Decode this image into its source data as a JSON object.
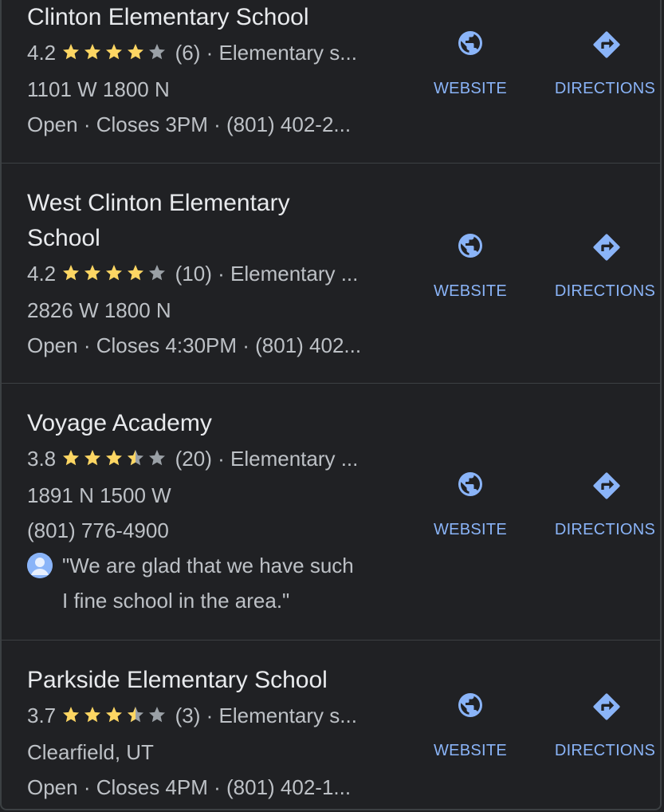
{
  "results": [
    {
      "name": "Clinton Elementary School",
      "rating": "4.2",
      "stars": 4.2,
      "reviews": "(6)",
      "category": "· Elementary s...",
      "address": "1101 W 1800 N",
      "status": "Open",
      "hours": "· Closes 3PM · (801) 402-2...",
      "website_label": "WEBSITE",
      "directions_label": "DIRECTIONS"
    },
    {
      "name_line1": "West Clinton Elementary",
      "name_line2": "School",
      "rating": "4.2",
      "stars": 4.2,
      "reviews": "(10)",
      "category": "· Elementary ...",
      "address": "2826 W 1800 N",
      "status": "Open",
      "hours": "· Closes 4:30PM · (801) 402...",
      "website_label": "WEBSITE",
      "directions_label": "DIRECTIONS"
    },
    {
      "name": "Voyage Academy",
      "rating": "3.8",
      "stars": 3.8,
      "reviews": "(20)",
      "category": "· Elementary ...",
      "address": "1891 N 1500 W",
      "phone": "(801) 776-4900",
      "review_line1": "\"We are glad that we have such",
      "review_line2": "I fine school in the area.\"",
      "website_label": "WEBSITE",
      "directions_label": "DIRECTIONS"
    },
    {
      "name": "Parkside Elementary School",
      "rating": "3.7",
      "stars": 3.7,
      "reviews": "(3)",
      "category": "· Elementary s...",
      "address": "Clearfield, UT",
      "status": "Open",
      "hours": "· Closes 4PM · (801) 402-1...",
      "website_label": "WEBSITE",
      "directions_label": "DIRECTIONS"
    }
  ],
  "colors": {
    "accent": "#8ab4f8",
    "star": "#fdd663",
    "star_empty": "#9aa0a6",
    "bg": "#202124",
    "text": "#e8eaed",
    "muted": "#bdc1c6"
  }
}
